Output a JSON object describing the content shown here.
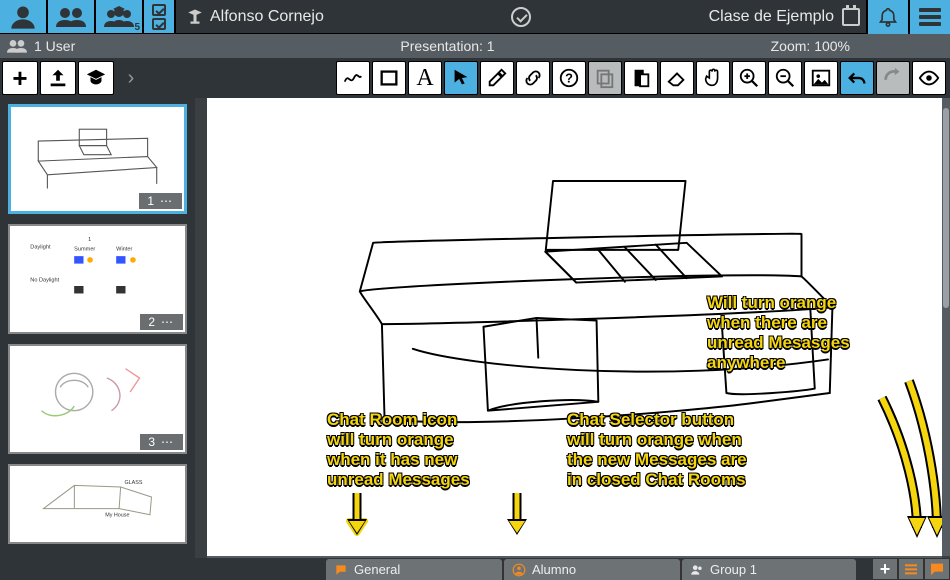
{
  "header": {
    "user_name": "Alfonso Cornejo",
    "class_name": "Clase de Ejemplo",
    "user_count_label": "1 User",
    "presentation_label": "Presentation: 1",
    "zoom_label": "Zoom: 100%",
    "mode_badge": "5"
  },
  "thumbs": [
    {
      "page": "1"
    },
    {
      "page": "2"
    },
    {
      "page": "3"
    },
    {
      "page": ""
    }
  ],
  "chat": {
    "tabs": [
      {
        "label": "General",
        "icon": "chat-bubble",
        "color": "#f68a1e"
      },
      {
        "label": "Alumno",
        "icon": "user-circle",
        "color": "#f68a1e"
      },
      {
        "label": "Group 1",
        "icon": "users",
        "color": "#e8e8e8"
      }
    ]
  },
  "annotations": {
    "a1": "Chat Room icon\nwill turn orange\nwhen it has new\nunread Messages",
    "a2": "Chat Selector button\nwill turn orange when\nthe new Messages are\nin closed Chat Rooms",
    "a3": "Will turn orange\nwhen there are\nunread Mesasges\nanywhere"
  },
  "tools": {
    "letter_A": "A"
  }
}
